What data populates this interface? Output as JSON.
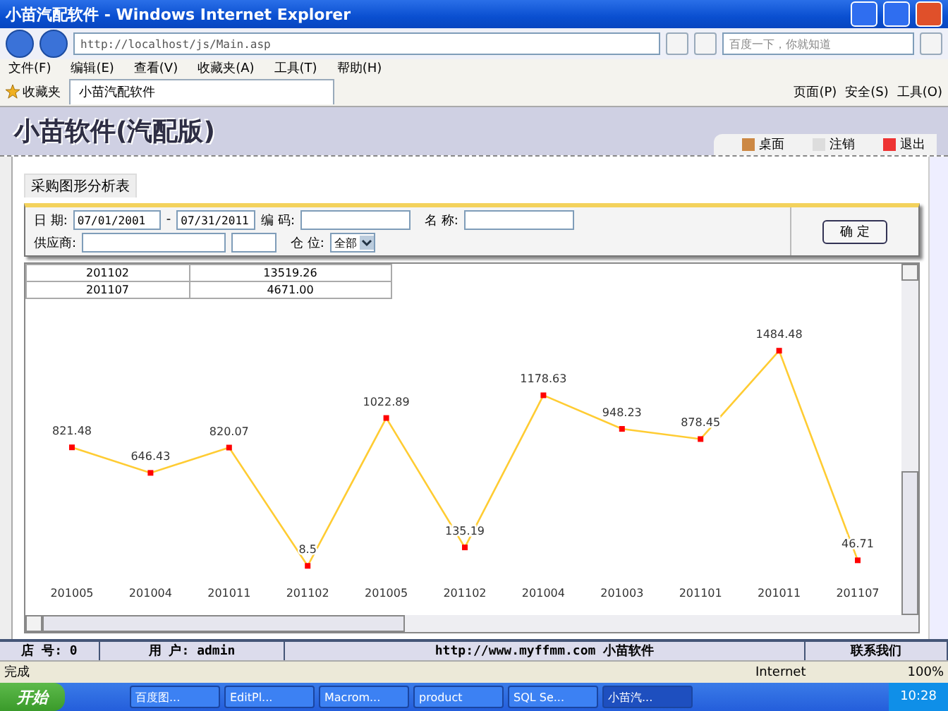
{
  "browser": {
    "title": "小苗汽配软件 - Windows Internet Explorer",
    "address": "http://localhost/js/Main.asp",
    "search_placeholder": "百度一下，你就知道",
    "menu": [
      "文件(F)",
      "编辑(E)",
      "查看(V)",
      "收藏夹(A)",
      "工具(T)",
      "帮助(H)"
    ],
    "favorites_label": "收藏夹",
    "tab_title": "小苗汽配软件",
    "commands": [
      "页面(P)",
      "安全(S)",
      "工具(O)"
    ]
  },
  "app": {
    "title": "小苗软件(汽配版)",
    "toolbar": [
      {
        "label": "桌面",
        "kind": "desktop"
      },
      {
        "label": "注销",
        "kind": "logout"
      },
      {
        "label": "退出",
        "kind": "exit"
      }
    ]
  },
  "report_tab": "采购图形分析表",
  "filters": {
    "date_label": "日 期:",
    "date_from": "07/01/2001",
    "date_separator": "-",
    "date_to": "07/31/2011",
    "code_label": "编 码:",
    "name_label": "名 称:",
    "supplier_label": "供应商:",
    "warehouse_label": "仓 位:",
    "warehouse_value": "全部",
    "confirm": "确 定"
  },
  "summary_rows": [
    [
      "201102",
      "13519.26"
    ],
    [
      "201107",
      "4671.00"
    ]
  ],
  "chart_data": {
    "type": "line",
    "categories": [
      "201005",
      "201004",
      "201011",
      "201102",
      "201005",
      "201102",
      "201004",
      "201003",
      "201101",
      "201011",
      "201107"
    ],
    "data_labels": true,
    "series": [
      {
        "marker": "square",
        "color": "#ffcc33",
        "values": [
          821.48,
          646.43,
          820.07,
          8.5,
          1022.89,
          135.19,
          1178.63,
          948.23,
          878.45,
          1484.48,
          46.71
        ]
      }
    ]
  },
  "footer": [
    "店 号: 0",
    "用 户: admin",
    "http://www.myffmm.com 小苗软件",
    "联系我们"
  ],
  "ie_status": {
    "text": "完成",
    "zone": "Internet",
    "zoom": "100%"
  },
  "taskbar": {
    "start": "开始",
    "tasks": [
      {
        "label": "百度图...",
        "selected": false
      },
      {
        "label": "EditPl...",
        "selected": false
      },
      {
        "label": "Macrom...",
        "selected": false
      },
      {
        "label": "product",
        "selected": false
      },
      {
        "label": "SQL Se...",
        "selected": false
      },
      {
        "label": "小苗汽...",
        "selected": true
      }
    ],
    "clock": "10:28"
  }
}
